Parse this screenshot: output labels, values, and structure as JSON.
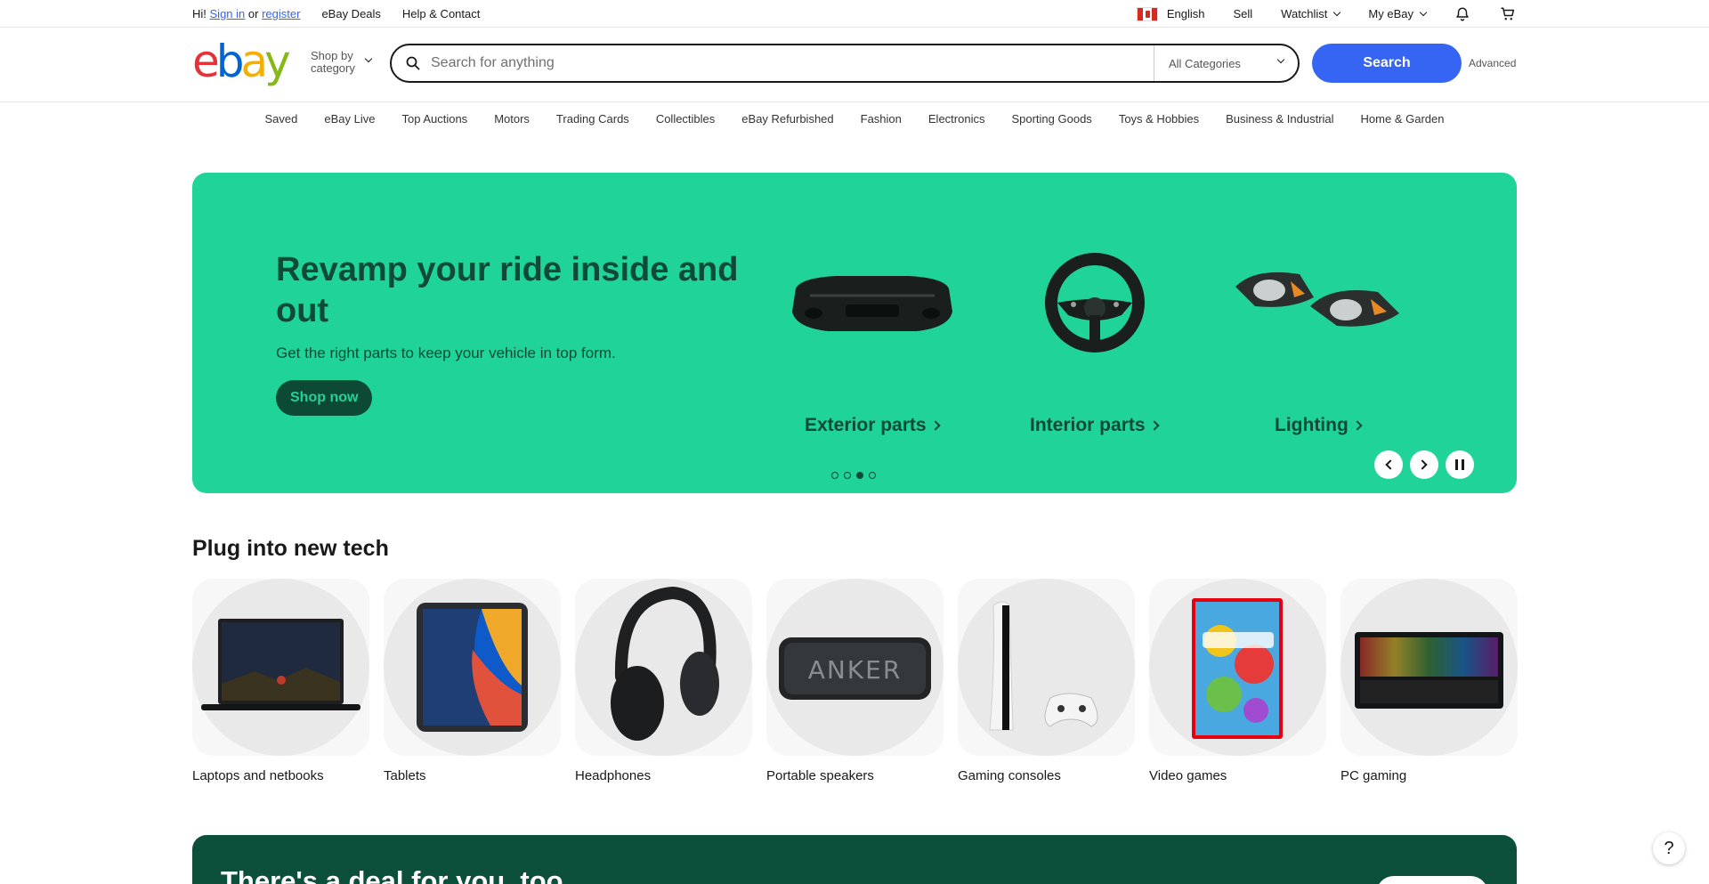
{
  "topbar": {
    "greeting_prefix": "Hi!",
    "sign_in": "Sign in",
    "or": "or",
    "register": "register",
    "deals": "eBay Deals",
    "help": "Help & Contact",
    "language": "English",
    "sell": "Sell",
    "watchlist": "Watchlist",
    "my_ebay": "My eBay"
  },
  "header": {
    "logo": {
      "e": "e",
      "b": "b",
      "a": "a",
      "y": "y"
    },
    "shop_by_line1": "Shop by",
    "shop_by_line2": "category",
    "search_placeholder": "Search for anything",
    "category_select": "All Categories",
    "search_button": "Search",
    "advanced": "Advanced"
  },
  "nav": {
    "items": [
      "Saved",
      "eBay Live",
      "Top Auctions",
      "Motors",
      "Trading Cards",
      "Collectibles",
      "eBay Refurbished",
      "Fashion",
      "Electronics",
      "Sporting Goods",
      "Toys & Hobbies",
      "Business & Industrial",
      "Home & Garden"
    ]
  },
  "hero": {
    "title": "Revamp your ride inside and out",
    "subtitle": "Get the right parts to keep your vehicle in top form.",
    "cta": "Shop now",
    "tiles": [
      {
        "label": "Exterior parts",
        "icon": "bumper-icon"
      },
      {
        "label": "Interior parts",
        "icon": "steering-wheel-icon"
      },
      {
        "label": "Lighting",
        "icon": "headlights-icon"
      }
    ],
    "slide_count": 4,
    "active_slide": 3,
    "bg_color": "#20d399"
  },
  "tech": {
    "title": "Plug into new tech",
    "items": [
      {
        "label": "Laptops and netbooks"
      },
      {
        "label": "Tablets"
      },
      {
        "label": "Headphones"
      },
      {
        "label": "Portable speakers",
        "brand_text": "ANKER"
      },
      {
        "label": "Gaming consoles"
      },
      {
        "label": "Video games"
      },
      {
        "label": "PC gaming"
      }
    ]
  },
  "deal": {
    "title": "There's a deal for you, too"
  },
  "help_label": "?",
  "colors": {
    "accent": "#3665f3",
    "hero_dark": "#0f4a37",
    "deal_bg": "#0c4f3a"
  }
}
